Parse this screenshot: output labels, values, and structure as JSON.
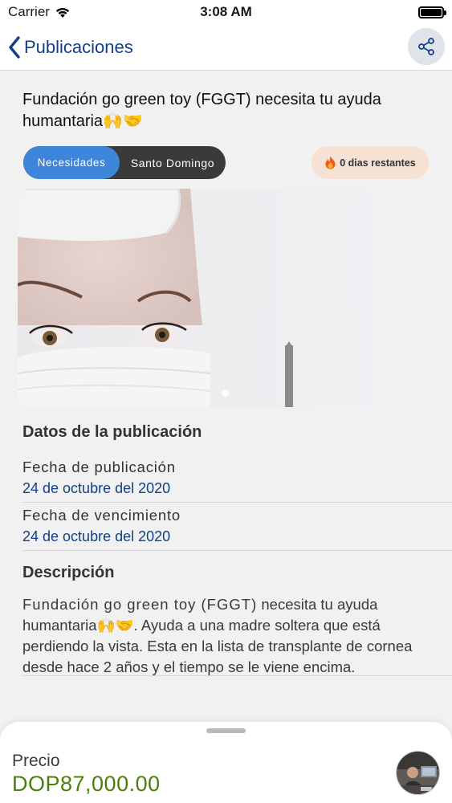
{
  "status_bar": {
    "carrier": "Carrier",
    "time": "3:08 AM"
  },
  "nav": {
    "back_label": "Publicaciones"
  },
  "post": {
    "title": "Fundación go green toy (FGGT) necesita tu ayuda humantaria🙌🤝",
    "category_chip": "Necesidades",
    "location_chip": "Santo Domingo",
    "days_remaining": "0 dias restantes"
  },
  "details": {
    "section_title": "Datos de la publicación",
    "publication_date_label": "Fecha de publicación",
    "publication_date_value": "24 de octubre del 2020",
    "expiration_date_label": "Fecha de vencimiento",
    "expiration_date_value": "24 de octubre del 2020"
  },
  "description": {
    "section_title": "Descripción",
    "org_name": "Fundación go green toy (FGGT)",
    "text": " necesita tu ayuda humantaria🙌🤝. Ayuda a una madre soltera que está perdiendo la vista. Esta en la lista de transplante de cornea desde hace 2 años y el tiempo se le viene encima."
  },
  "footer": {
    "price_label": "Precio",
    "price_value": "DOP87,000.00"
  },
  "colors": {
    "accent_blue": "#123f8a",
    "chip_active": "#3d86d9",
    "price_green": "#4b7f0b",
    "days_badge_bg": "#f6e2d4"
  },
  "icons": {
    "back": "chevron-left-icon",
    "share": "share-icon",
    "fire": "fire-icon",
    "wifi": "wifi-icon",
    "battery": "battery-icon"
  }
}
